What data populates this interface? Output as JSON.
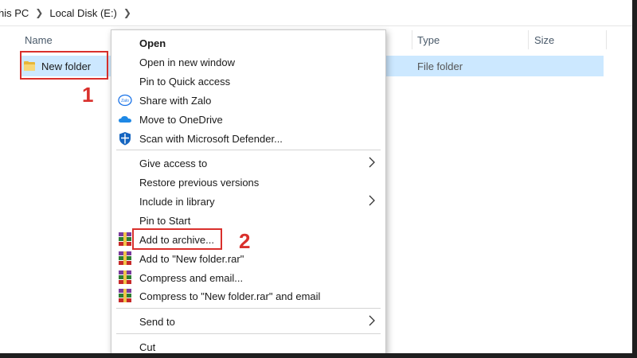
{
  "breadcrumb": {
    "items": [
      "his PC",
      "Local Disk (E:)"
    ]
  },
  "columns": {
    "name": "Name",
    "type": "Type",
    "size": "Size"
  },
  "file_row": {
    "name": "New folder",
    "type": "File folder"
  },
  "annotations": {
    "step1": "1",
    "step2": "2",
    "color": "#d9302c"
  },
  "context_menu": {
    "group1": [
      {
        "label": "Open",
        "icon": null
      },
      {
        "label": "Open in new window",
        "icon": null
      },
      {
        "label": "Pin to Quick access",
        "icon": null
      },
      {
        "label": "Share with Zalo",
        "icon": "zalo-icon"
      },
      {
        "label": "Move to OneDrive",
        "icon": "onedrive-icon"
      },
      {
        "label": "Scan with Microsoft Defender...",
        "icon": "defender-shield-icon"
      }
    ],
    "group2": [
      {
        "label": "Give access to",
        "submenu": true
      },
      {
        "label": "Restore previous versions"
      },
      {
        "label": "Include in library",
        "submenu": true
      },
      {
        "label": "Pin to Start"
      },
      {
        "label": "Add to archive...",
        "icon": "winrar-icon"
      },
      {
        "label": "Add to \"New folder.rar\"",
        "icon": "winrar-icon"
      },
      {
        "label": "Compress and email...",
        "icon": "winrar-icon"
      },
      {
        "label": "Compress to \"New folder.rar\" and email",
        "icon": "winrar-icon"
      }
    ],
    "group3": [
      {
        "label": "Send to",
        "submenu": true
      }
    ],
    "group4": [
      {
        "label": "Cut"
      }
    ]
  },
  "colors": {
    "selection": "#cce8ff",
    "folder": "#f8d775"
  }
}
